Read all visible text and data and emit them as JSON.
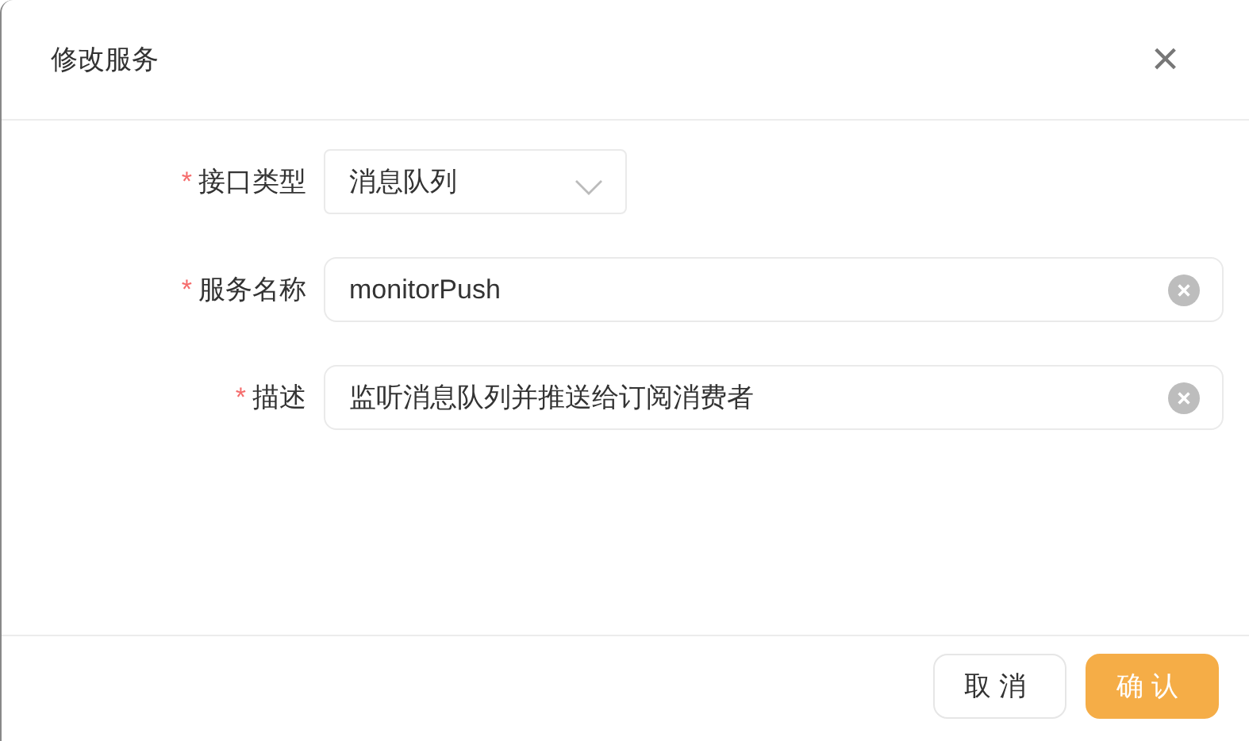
{
  "dialog": {
    "title": "修改服务",
    "close": "×"
  },
  "fields": [
    {
      "kind": "select",
      "mark": "*",
      "label": "接口类型",
      "value": "消息队列"
    },
    {
      "kind": "input",
      "mark": "*",
      "label": "服务名称",
      "value": "monitorPush"
    },
    {
      "kind": "input",
      "mark": "*",
      "label": "描述",
      "value": "监听消息队列并推送给订阅消费者"
    }
  ],
  "buttons": [
    {
      "label": "取消",
      "kind": "default"
    },
    {
      "label": "确认",
      "kind": "primary"
    }
  ]
}
